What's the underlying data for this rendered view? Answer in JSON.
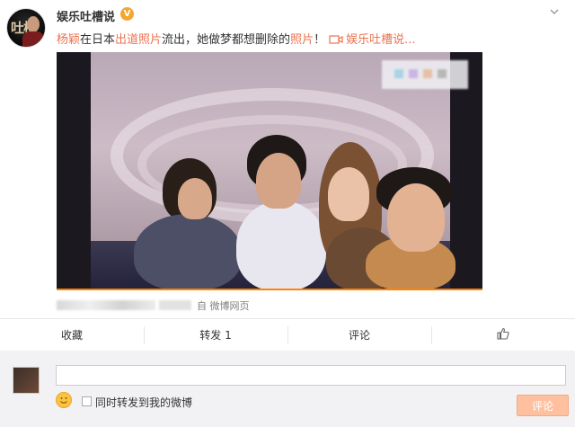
{
  "author": {
    "name": "娱乐吐槽说",
    "verified_badge": "V",
    "avatar_text": "吐槽"
  },
  "post": {
    "segments": [
      {
        "text": "杨颖",
        "style": "highlight"
      },
      {
        "text": "在日本",
        "style": "plain"
      },
      {
        "text": "出道照片",
        "style": "highlight"
      },
      {
        "text": "流出，她做梦都想删除的",
        "style": "plain"
      },
      {
        "text": "照片",
        "style": "highlight"
      },
      {
        "text": "！",
        "style": "plain"
      }
    ],
    "video_link": "娱乐吐槽说...",
    "source": "自 微博网页"
  },
  "actions": {
    "collect": "收藏",
    "repost": "转发 1",
    "comment": "评论",
    "like_icon": "thumbs-up-icon"
  },
  "comment_box": {
    "placeholder": "",
    "repost_checkbox_label": "同时转发到我的微博",
    "submit_label": "评论"
  },
  "colors": {
    "accent": "#eb7350",
    "badge": "#f7a531",
    "button_disabled": "#ffc09f",
    "progress": "#ff8200"
  }
}
